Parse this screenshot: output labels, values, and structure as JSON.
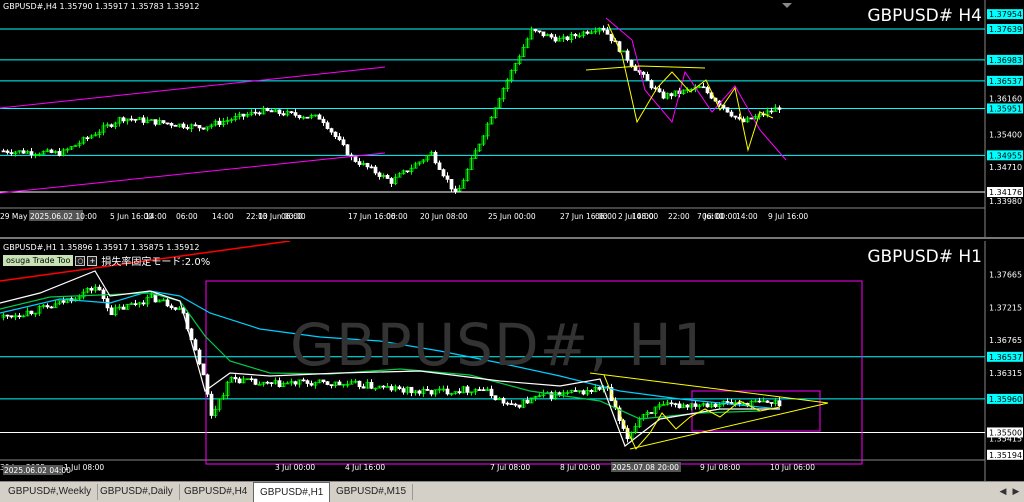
{
  "top": {
    "ohlc": "GBPUSD#,H4  1.35790 1.35917 1.35783 1.35912",
    "symbol": "GBPUSD#  H4",
    "price_labels": [
      "1.37954",
      "1.37639",
      "1.36983",
      "1.36537",
      "1.36160",
      "1.35951",
      "1.35400",
      "1.34955",
      "1.34710",
      "1.34176",
      "1.33980"
    ],
    "boxed_labels": [
      "1.37954",
      "1.37639",
      "1.36983",
      "1.36537",
      "1.35951",
      "1.34955",
      "1.34176"
    ],
    "time_labels": [
      "29 May 2025",
      "2025.06.02 10:00",
      "5 Jun 16:00",
      "14:00",
      "22:00",
      "06:00",
      "14:00",
      "22:00",
      "06:00",
      "10 Jun 08:00",
      "13 Jun 00:00",
      "17 Jun 16:00",
      "22:00",
      "06:00",
      "14:00",
      "20 Jun 08:00",
      "25 Jun 00:00",
      "27 Jun 16:00",
      "06:00",
      "14:00",
      "22:00",
      "2 Jul 08:00",
      "06:00",
      "14:00",
      "22:00",
      "7 Jul 00:00",
      "9 Jul 16:00"
    ]
  },
  "bottom": {
    "ohlc": "GBPUSD#,H1  1.35896 1.35917 1.35875 1.35912",
    "symbol": "GBPUSD# H1",
    "watermark": "GBPUSD#, H1",
    "tool_name": "osuga Trade Too",
    "tool_text": "損失率固定モード:2.0%",
    "price_labels": [
      "1.37665",
      "1.37215",
      "1.36765",
      "1.36537",
      "1.36315",
      "1.35960",
      "1.35500",
      "1.35415",
      "1.35194"
    ],
    "boxed_labels": [
      "1.36537",
      "1.35960",
      "1.35500",
      "1.35194"
    ],
    "time_labels": [
      "30 Jun 2025",
      "2025.06.02 04:00",
      "1 Jul 08:00",
      "3 Jul 00:00",
      "4 Jul 16:00",
      "7 Jul 08:00",
      "8 Jul 00:00",
      "9 Jul 08:00",
      "10 Jul 06:00",
      "2025.07.08 20:00"
    ]
  },
  "tabs": [
    "GBPUSD#,Weekly",
    "GBPUSD#,Daily",
    "GBPUSD#,H4",
    "GBPUSD#,H1",
    "GBPUSD#,M15"
  ],
  "active_tab": "GBPUSD#,H1",
  "colors": {
    "bull": "#00ff00",
    "bear": "#ffffff",
    "level": "#00ffff",
    "magenta": "#ff00ff",
    "yellow": "#ffff00",
    "red": "#ff0000"
  }
}
